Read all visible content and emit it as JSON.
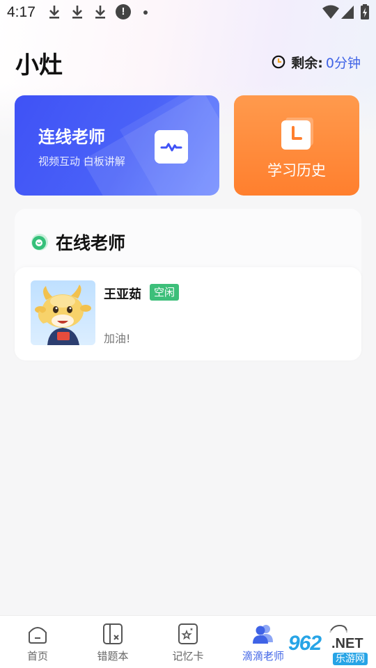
{
  "status_bar": {
    "time": "4:17"
  },
  "header": {
    "title": "小灶",
    "remaining_label": "剩余:",
    "remaining_value": "0分钟"
  },
  "cards": {
    "live_teacher": {
      "title": "连线老师",
      "subtitle": "视频互动 白板讲解"
    },
    "history": {
      "title": "学习历史"
    }
  },
  "online_teachers": {
    "title": "在线老师",
    "teachers": [
      {
        "name": "王亚茹",
        "status": "空闲",
        "message": "加油!"
      }
    ]
  },
  "bottom_nav": {
    "items": [
      {
        "label": "首页",
        "icon": "home-icon"
      },
      {
        "label": "错题本",
        "icon": "mistake-book-icon"
      },
      {
        "label": "记忆卡",
        "icon": "memory-card-icon"
      },
      {
        "label": "滴滴老师",
        "icon": "teachers-icon",
        "active": true
      }
    ]
  },
  "watermark": {
    "number": "962",
    "suffix": ".NET",
    "site": "乐游网"
  },
  "colors": {
    "accent": "#3f63e6",
    "live_card": "#4a5ef7",
    "history_card": "#ff8a3a",
    "idle_badge": "#3dbf7a"
  }
}
